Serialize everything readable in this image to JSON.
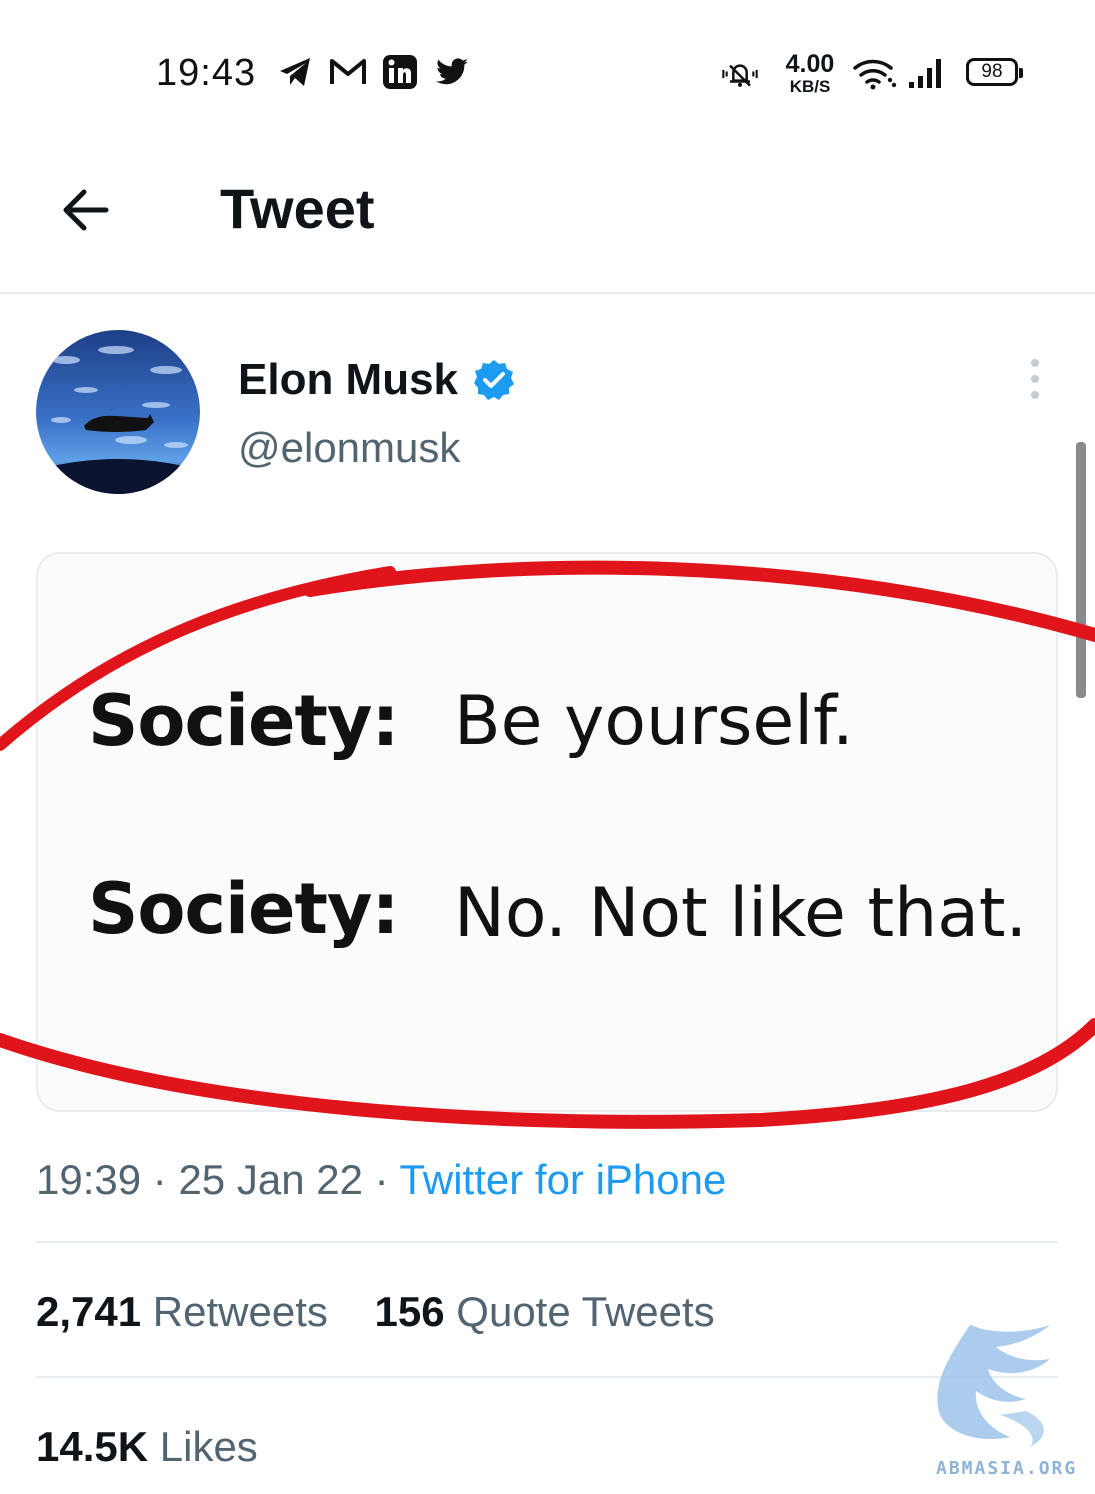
{
  "status_bar": {
    "time": "19:43",
    "left_icons": [
      "telegram-icon",
      "gmail-icon",
      "linkedin-icon",
      "twitter-icon"
    ],
    "net_speed_value": "4.00",
    "net_speed_unit": "KB/S",
    "battery": "98",
    "right_icons": [
      "vibrate-mute-icon",
      "wifi-icon",
      "signal-icon",
      "battery-icon"
    ]
  },
  "header": {
    "title": "Tweet",
    "back_icon": "back-arrow-icon"
  },
  "tweet": {
    "author_name": "Elon Musk",
    "author_handle": "@elonmusk",
    "verified": true,
    "media": {
      "lines": [
        {
          "speaker": "Society:",
          "text": "Be yourself."
        },
        {
          "speaker": "Society:",
          "text": "No. Not like that."
        }
      ]
    },
    "time": "19:39",
    "separator": "·",
    "date": "25 Jan 22",
    "source": "Twitter for iPhone",
    "retweets_count": "2,741",
    "retweets_label": "Retweets",
    "quotes_count": "156",
    "quotes_label": "Quote Tweets",
    "likes_count": "14.5K",
    "likes_label": "Likes"
  },
  "watermark": {
    "text": "ABMASIA.ORG"
  },
  "colors": {
    "accent": "#1d9bf0",
    "secondary_text": "#536471",
    "annotation_red": "#e0141b"
  }
}
